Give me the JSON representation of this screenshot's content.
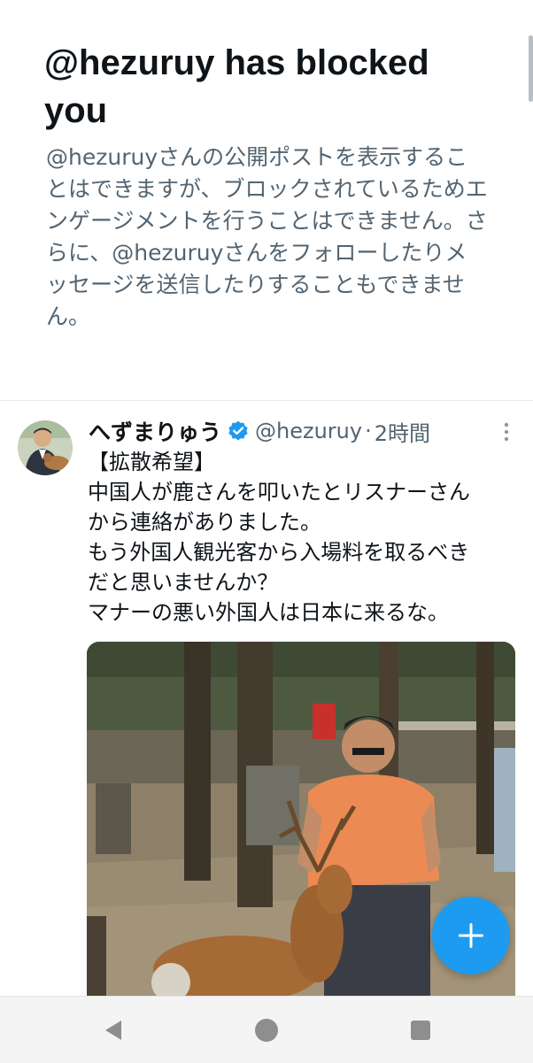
{
  "blocked_notice": {
    "title": "@hezuruy has blocked you",
    "description": "@hezuruyさんの公開ポストを表示することはできますが、ブロックされているためエンゲージメントを行うことはできません。さらに、@hezuruyさんをフォローしたりメッセージを送信したりすることもできません。"
  },
  "tweet": {
    "display_name": "へずまりゅう",
    "handle": "@hezuruy",
    "separator": "·",
    "time": "2時間",
    "verified": true,
    "text_lines": [
      "【拡散希望】",
      "中国人が鹿さんを叩いたとリスナーさん",
      "から連絡がありました。",
      "もう外国人観光客から入場料を取るべき",
      "だと思いませんか？",
      "マナーの悪い外国人は日本に来るな。"
    ]
  },
  "colors": {
    "accent": "#1d9bf0",
    "secondary_text": "#536471",
    "primary_text": "#0f1419"
  },
  "icons": {
    "verified": "verified-badge-icon",
    "more": "more-vertical-icon",
    "compose": "plus-icon",
    "nav_back": "back-triangle-icon",
    "nav_home": "home-circle-icon",
    "nav_recents": "recents-square-icon"
  }
}
